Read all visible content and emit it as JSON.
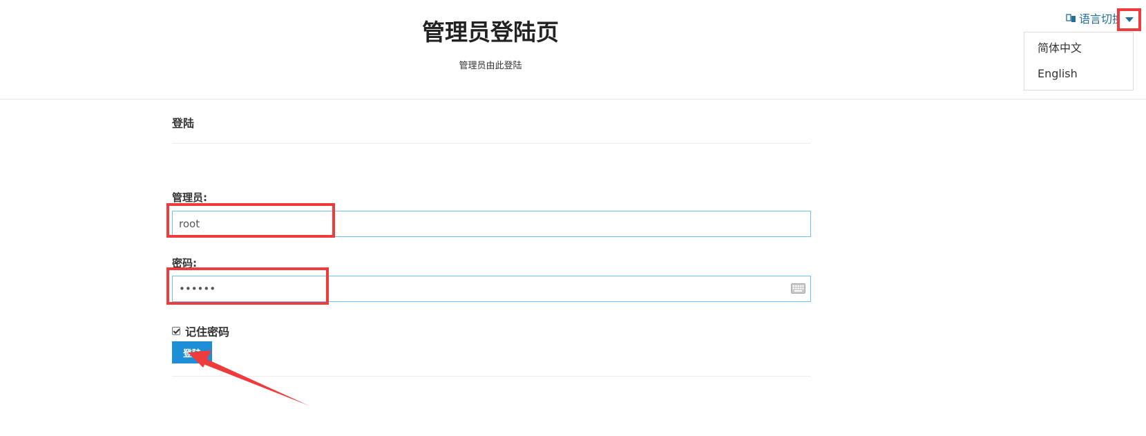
{
  "header": {
    "title": "管理员登陆页",
    "subtitle": "管理员由此登陆"
  },
  "language": {
    "toggle_label": "语言切换",
    "icon": "globe-icon",
    "options": [
      "简体中文",
      "English"
    ]
  },
  "form": {
    "section_title": "登陆",
    "username_label": "管理员:",
    "username_value": "root",
    "password_label": "密码:",
    "password_value": "••••••",
    "remember_label": "记住密码",
    "remember_checked": true,
    "submit_label": "登陆"
  },
  "colors": {
    "accent": "#1e8fd6",
    "input_border": "#6cc3ec",
    "annotation": "#ef3b3b",
    "link": "#1f6f9c"
  }
}
